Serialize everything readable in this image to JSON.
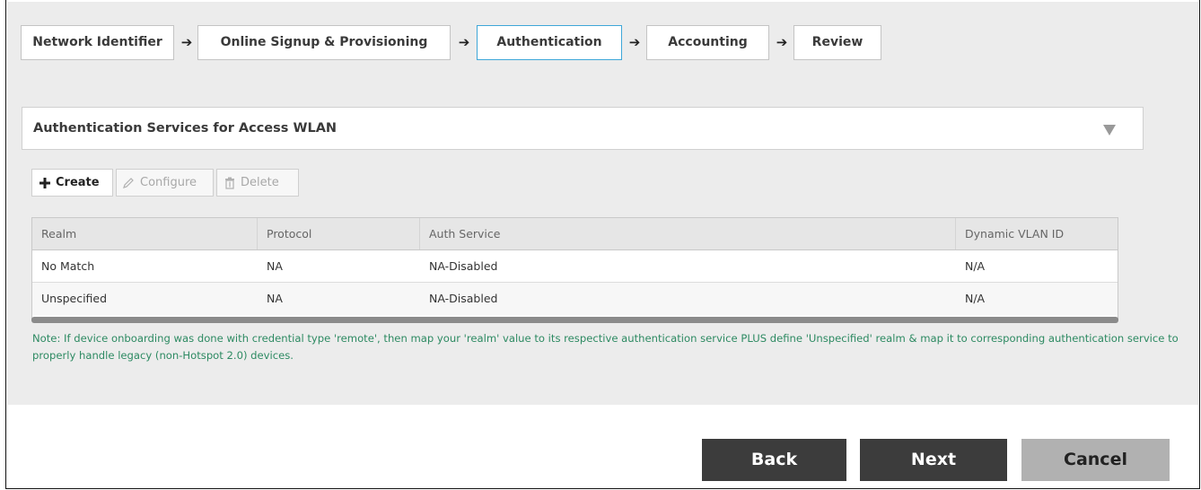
{
  "wizard": {
    "steps": [
      {
        "label": "Network Identifier"
      },
      {
        "label": "Online Signup & Provisioning"
      },
      {
        "label": "Authentication"
      },
      {
        "label": "Accounting"
      },
      {
        "label": "Review"
      }
    ],
    "active_step": "Authentication",
    "arrow_glyph": "➔"
  },
  "section": {
    "title": "Authentication Services for Access WLAN"
  },
  "toolbar": {
    "create_label": "Create",
    "configure_label": "Configure",
    "delete_label": "Delete"
  },
  "table": {
    "columns": [
      "Realm",
      "Protocol",
      "Auth Service",
      "Dynamic VLAN ID"
    ],
    "rows": [
      {
        "realm": "No Match",
        "protocol": "NA",
        "auth_service": "NA-Disabled",
        "vlan": "N/A"
      },
      {
        "realm": "Unspecified",
        "protocol": "NA",
        "auth_service": "NA-Disabled",
        "vlan": "N/A"
      }
    ]
  },
  "note": "Note: If device onboarding was done with credential type 'remote', then map your 'realm' value to its respective authentication service PLUS define 'Unspecified' realm & map it to corresponding authentication service to properly handle legacy (non-Hotspot 2.0) devices.",
  "buttons": {
    "back_label": "Back",
    "next_label": "Next",
    "cancel_label": "Cancel"
  },
  "colors": {
    "active_step_border": "#3ea7d8",
    "note_text": "#2d8a62",
    "primary_button": "#3c3c3c",
    "cancel_button": "#b1b1b1"
  }
}
